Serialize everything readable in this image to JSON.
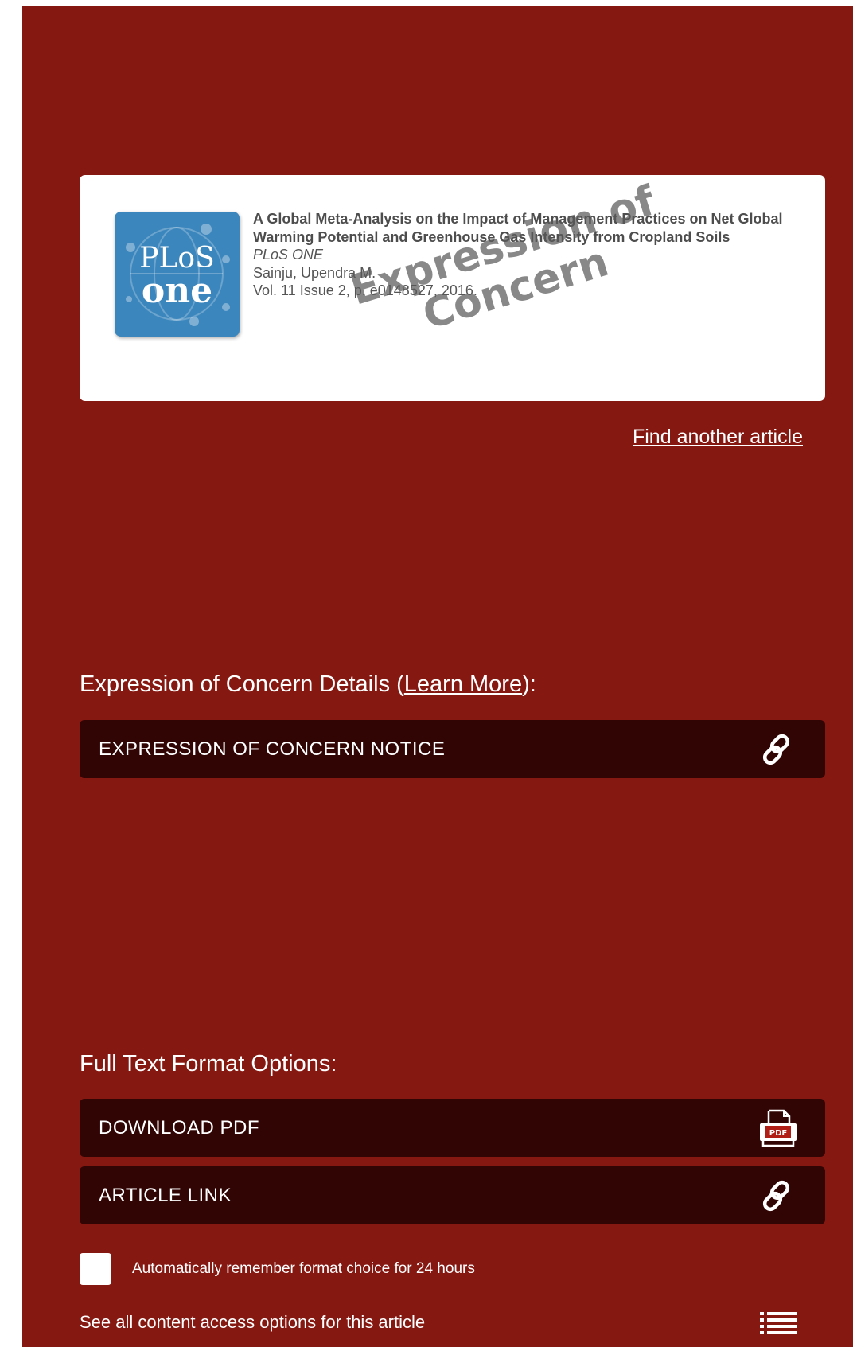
{
  "article": {
    "title": "A Global Meta-Analysis on the Impact of Management Practices on Net Global Warming Potential and Greenhouse Gas Intensity from Cropland Soils",
    "journal": "PLoS ONE",
    "author": "Sainju, Upendra M.",
    "citation": "Vol. 11 Issue 2, p. e0148527, 2016.",
    "cover_line1": "PLoS",
    "cover_line2": "one",
    "stamp_line1": "Expression of",
    "stamp_line2": "Concern"
  },
  "find_another": "Find another article",
  "eoc": {
    "heading_prefix": "Expression of Concern Details (",
    "learn_more": "Learn More",
    "heading_suffix": "):",
    "notice_label": "EXPRESSION OF CONCERN NOTICE",
    "notice_icon": "link-icon"
  },
  "formats": {
    "heading": "Full Text Format Options:",
    "pdf_label": "DOWNLOAD PDF",
    "pdf_icon": "pdf-icon",
    "pdf_icon_text": "PDF",
    "link_label": "ARTICLE LINK",
    "link_icon": "link-icon"
  },
  "remember": {
    "label": "Automatically remember format choice for 24 hours",
    "checked": false
  },
  "see_all": "See all content access options for this article",
  "colors": {
    "background": "#861812",
    "bar": "#320505",
    "cover": "#3b86bd"
  }
}
